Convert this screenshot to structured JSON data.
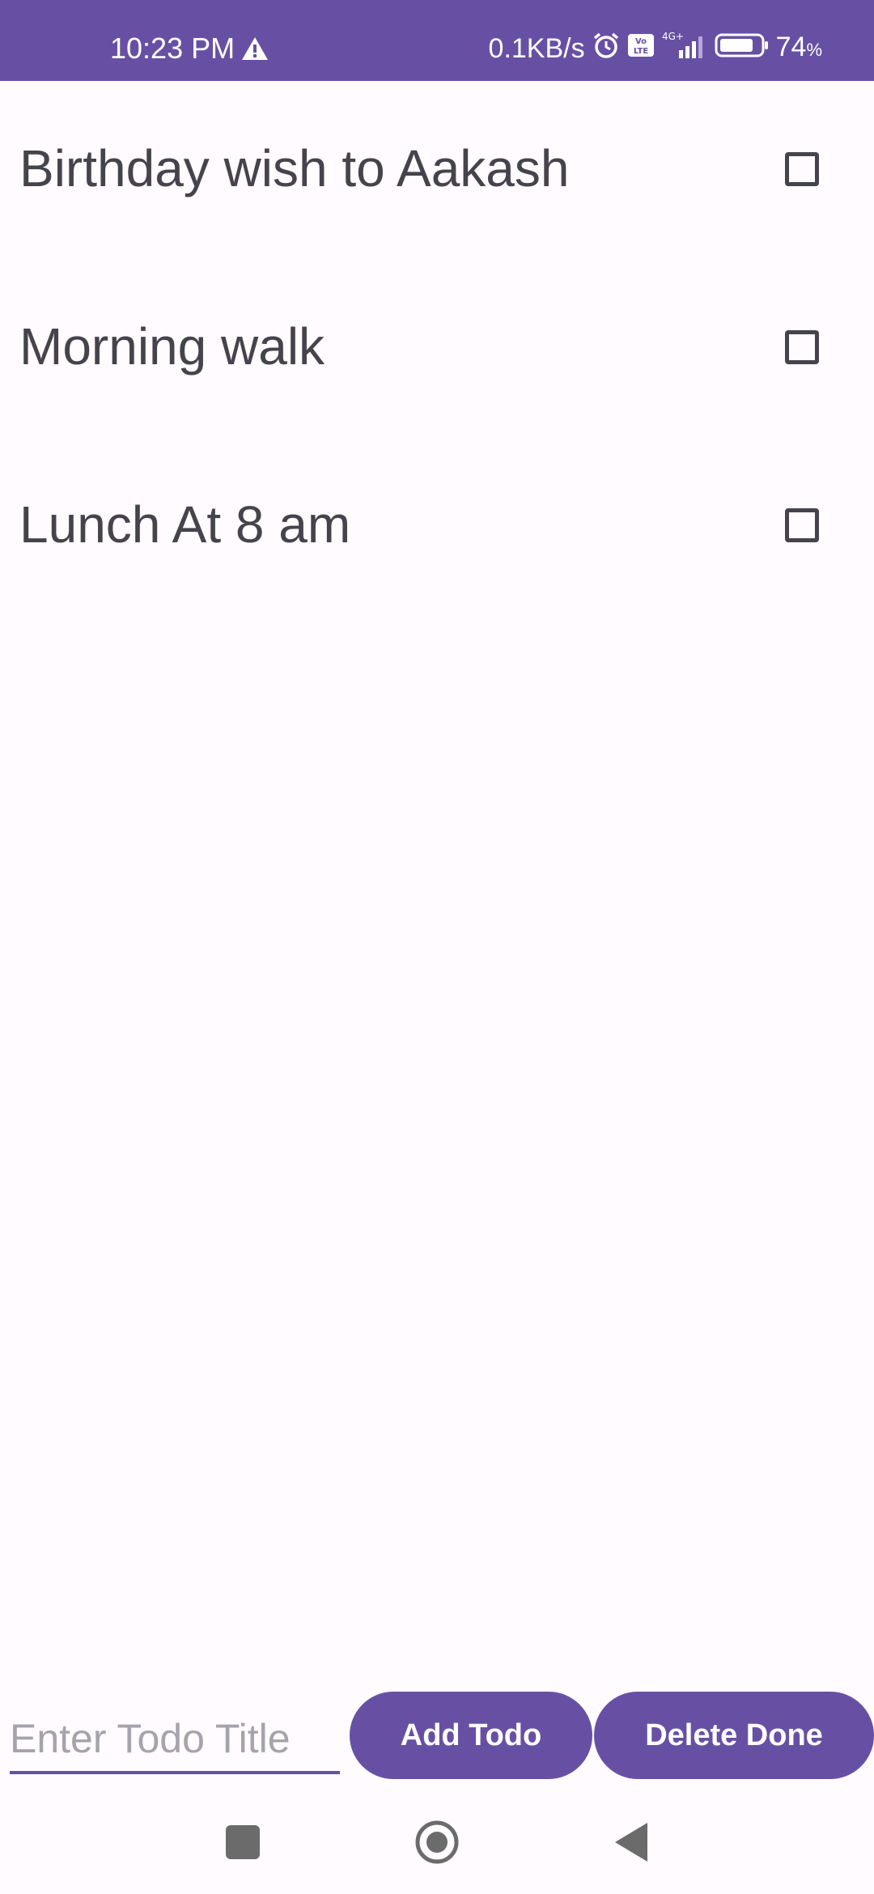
{
  "status_bar": {
    "time": "10:23 PM",
    "network_speed": "0.1KB/s",
    "network_type": "4G+",
    "volte_label": "Vo LTE",
    "battery_level": "74",
    "battery_unit": "%",
    "icons": [
      "warning-icon",
      "alarm-icon",
      "volte-icon",
      "signal-icon",
      "battery-icon"
    ],
    "background_color": "#6750a4"
  },
  "todos": [
    {
      "title": "Birthday wish to Aakash",
      "done": false
    },
    {
      "title": "Morning walk",
      "done": false
    },
    {
      "title": "Lunch At 8 am",
      "done": false
    }
  ],
  "input_row": {
    "placeholder": "Enter Todo Title",
    "value": "",
    "add_label": "Add Todo",
    "delete_label": "Delete Done"
  },
  "nav_bar": {
    "icons": [
      "recents-icon",
      "home-icon",
      "back-icon"
    ]
  },
  "colors": {
    "accent": "#6750a4",
    "background": "#fffbfe",
    "text": "#45434c"
  }
}
